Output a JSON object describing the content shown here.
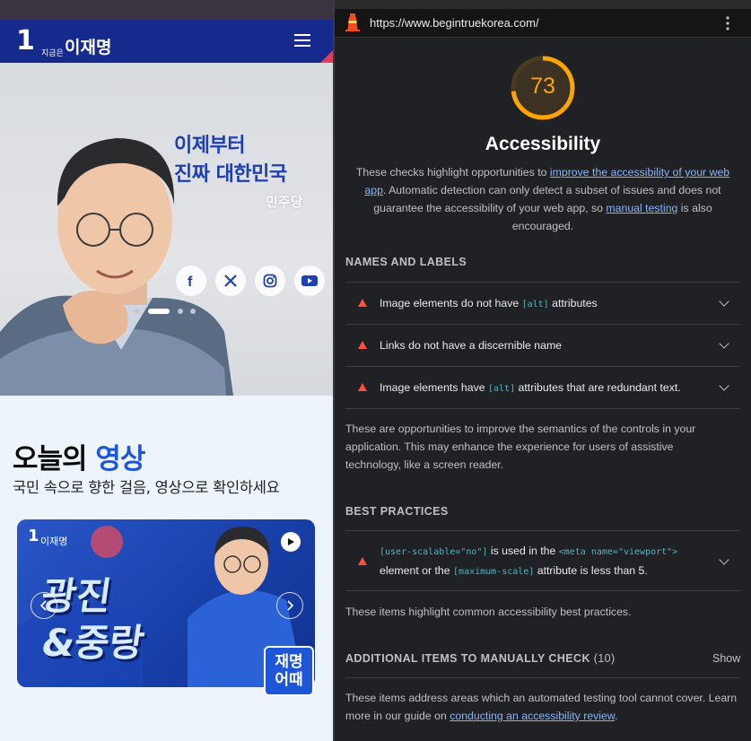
{
  "site": {
    "logo_number": "1",
    "logo_small": "지금은",
    "logo_name": "이재명",
    "hero_line1": "이제부터",
    "hero_line2": "진짜 대한민국",
    "party_name": "민주당",
    "social_icons": [
      "facebook-icon",
      "x-icon",
      "instagram-icon",
      "youtube-icon"
    ],
    "carousel": {
      "slides": 4,
      "active_index": 1
    },
    "section_title_part1": "오늘의",
    "section_title_part2": "영상",
    "section_subtitle": "국민 속으로 향한 걸음, 영상으로 확인하세요",
    "video": {
      "title_line1": "광진",
      "title_line2": "&중랑",
      "badge_line1": "재명",
      "badge_line2": "어때",
      "label_number": "1",
      "label_name": "이재명"
    },
    "colors": {
      "header": "#152a8c",
      "accent": "#1e56d8",
      "corner": "#e23d5a"
    }
  },
  "lighthouse": {
    "url": "https://www.begintruekorea.com/",
    "score": "73",
    "score_value": 73,
    "category_title": "Accessibility",
    "desc_part1": "These checks highlight opportunities to ",
    "desc_link1": "improve the accessibility of your web app",
    "desc_part2": ". Automatic detection can only detect a subset of issues and does not guarantee the accessibility of your web app, so ",
    "desc_link2": "manual testing",
    "desc_part3": " is also encouraged.",
    "groups": {
      "names_labels": {
        "title": "NAMES AND LABELS",
        "audits": [
          {
            "pre": "Image elements do not have ",
            "code": "[alt]",
            "post": " attributes"
          },
          {
            "pre": "Links do not have a discernible name",
            "code": "",
            "post": ""
          },
          {
            "pre": "Image elements have ",
            "code": "[alt]",
            "post": " attributes that are redundant text."
          }
        ],
        "description": "These are opportunities to improve the semantics of the controls in your application. This may enhance the experience for users of assistive technology, like a screen reader."
      },
      "best_practices": {
        "title": "BEST PRACTICES",
        "audit": {
          "code1": "[user-scalable=\"no\"]",
          "text1": " is used in the ",
          "code2": "<meta name=\"viewport\">",
          "text2": "element or the ",
          "code3": "[maximum-scale]",
          "text3": " attribute is less than 5."
        },
        "description": "These items highlight common accessibility best practices."
      },
      "manual": {
        "title": "ADDITIONAL ITEMS TO MANUALLY CHECK",
        "count": "(10)",
        "show_label": "Show",
        "desc_part1": "These items address areas which an automated testing tool cannot cover. Learn more in our guide on ",
        "desc_link": "conducting an accessibility review",
        "desc_part2": "."
      }
    },
    "colors": {
      "score": "#ffa400",
      "fail": "#ff4e42",
      "link": "#8ab4f8",
      "code": "#4fb4c9"
    }
  }
}
